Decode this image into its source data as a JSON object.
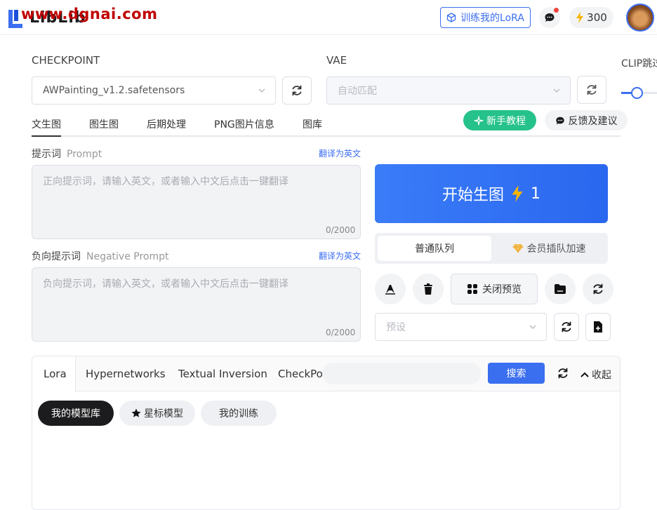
{
  "header": {
    "logo_text": "LibLib",
    "watermark": "www.dgnai.com",
    "train_button": "训练我的LoRA",
    "points": "300"
  },
  "model": {
    "checkpoint_label": "CHECKPOINT",
    "checkpoint_value": "AWPainting_v1.2.safetensors",
    "vae_label": "VAE",
    "vae_placeholder": "自动匹配",
    "clip_label": "CLIP跳过"
  },
  "tabs": [
    "文生图",
    "图生图",
    "后期处理",
    "PNG图片信息",
    "图库"
  ],
  "actions": {
    "tutorial": "新手教程",
    "feedback": "反馈及建议"
  },
  "prompt": {
    "title": "提示词",
    "title_en": "Prompt",
    "translate": "翻译为英文",
    "placeholder": "正向提示词，请输入英文，或者输入中文后点击一键翻译",
    "counter": "0/2000"
  },
  "negative": {
    "title": "负向提示词",
    "title_en": "Negative Prompt",
    "translate": "翻译为英文",
    "placeholder": "负向提示词，请输入英文，或者输入中文后点击一键翻译",
    "counter": "0/2000"
  },
  "generate": {
    "label": "开始生图",
    "cost": "1"
  },
  "queue": {
    "normal": "普通队列",
    "vip": "会员插队加速"
  },
  "tools": {
    "preview": "关闭预览",
    "preset_placeholder": "预设"
  },
  "panel": {
    "tabs": [
      "Lora",
      "Hypernetworks",
      "Textual Inversion",
      "CheckPoint"
    ],
    "search": "搜索",
    "collapse": "收起",
    "chips": [
      "我的模型库",
      "星标模型",
      "我的训练"
    ]
  }
}
